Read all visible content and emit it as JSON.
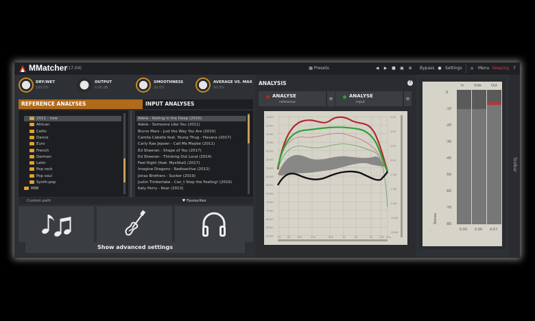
{
  "app": {
    "name": "MMatcher",
    "version": "(17.04)"
  },
  "titlebar": {
    "presets": "Presets",
    "bypass": "Bypass",
    "settings": "Settings",
    "menu": "Menu",
    "status": "Keeping"
  },
  "knobs": [
    {
      "label": "DRY/WET",
      "value": "100.0%"
    },
    {
      "label": "OUTPUT",
      "value": "0.00 dB"
    },
    {
      "label": "SMOOTHNESS",
      "value": "20.0%"
    },
    {
      "label": "AVERAGE VS. MAX",
      "value": "50.0%"
    }
  ],
  "reference": {
    "title": "REFERENCE ANALYSES",
    "folders": [
      "2011 - now",
      "African",
      "Celtic",
      "Dance",
      "Euro",
      "French",
      "German",
      "Latin",
      "Pop rock",
      "Pop soul",
      "Synth-pop",
      "RBB"
    ],
    "custom_path": "Custom path"
  },
  "input": {
    "title": "INPUT ANALYSES",
    "tracks": [
      "Adele - Rolling in the Deep (2010)",
      "Adele - Someone Like You (2011)",
      "Bruno Mars - Just the Way You Are (2010)",
      "Camila Cabello feat. Young Thug - Havana (2017)",
      "Carly Rae Jepsen - Call Me Maybe (2011)",
      "Ed Sheeran - Shape of You (2017)",
      "Ed Sheeran - Thinking Out Loud (2014)",
      "Feel Right (feat. Mystikal) (2017)",
      "Imagine Dragons - Radioactive (2012)",
      "Jonas Brothers - Sucker (2019)",
      "Justin Timberlake - Can_t Stop the Feeling! (2016)",
      "Katy Perry - Roar (2013)"
    ],
    "favourites": "Favourites"
  },
  "advanced": "Show advanced settings",
  "analysis": {
    "title": "ANALYSIS",
    "reference_btn": {
      "label": "ANALYSE",
      "sub": "reference",
      "color": "#b02a2a"
    },
    "input_btn": {
      "label": "ANALYSE",
      "sub": "input",
      "color": "#2fa13a"
    },
    "y_labels_left": [
      "-20.00",
      "-25.00",
      "-30.00",
      "-35.00",
      "-40.00",
      "-45.00",
      "-50.00",
      "-55.00",
      "-60.00",
      "-65.00",
      "-70.00",
      "-75.00",
      "-80.00",
      "-85.00",
      "-90.00"
    ],
    "y_labels_right": [
      "5.00",
      "2.00",
      "1.00",
      "0.00",
      "-1.00",
      "-2.00",
      "-5.00",
      "-10.00",
      "-20.00"
    ],
    "x_labels": [
      "20",
      "50",
      "100",
      "200",
      "500",
      "1k",
      "2k",
      "5k",
      "10k",
      "20k"
    ]
  },
  "meter": {
    "columns": [
      "In",
      "Side",
      "Out"
    ],
    "scale": [
      "0",
      "-10",
      "-20",
      "-30",
      "-40",
      "-50",
      "-60",
      "-70",
      "-80"
    ],
    "values": [
      "0.00",
      "0.00",
      "4.57"
    ],
    "label": "Stereo"
  },
  "toolbar": "Toolbar"
}
